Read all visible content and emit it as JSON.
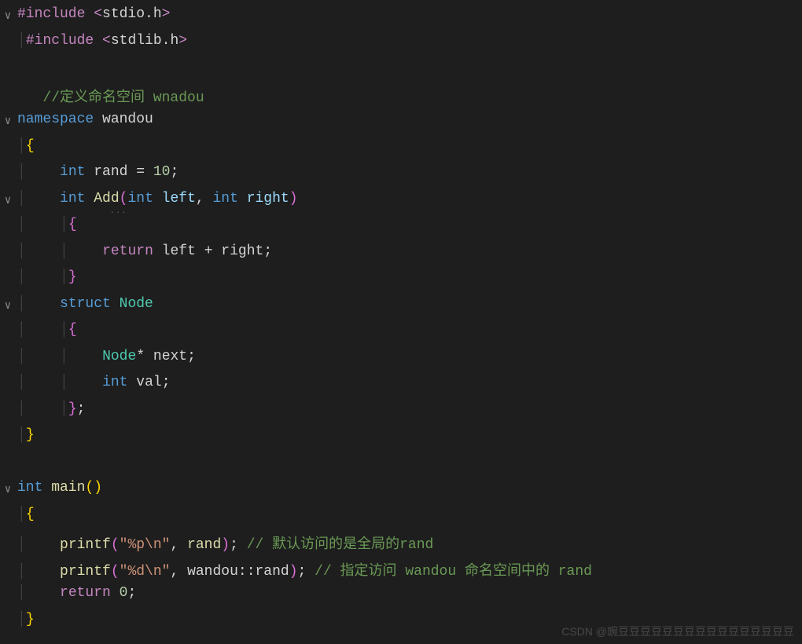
{
  "lines": {
    "l1_pre": "#include ",
    "l1_lt": "<",
    "l1_hdr": "stdio.h",
    "l1_gt": ">",
    "l2_pre": "#include ",
    "l2_lt": "<",
    "l2_hdr": "stdlib.h",
    "l2_gt": ">",
    "l4_comment": "//定义命名空间 wnadou",
    "l5_ns": "namespace",
    "l5_name": " wandou",
    "l6_brace": "{",
    "l7_int": "int",
    "l7_var": " rand ",
    "l7_eq": "= ",
    "l7_num": "10",
    "l7_semi": ";",
    "l8_int": "int",
    "l8_fn": " Add",
    "l8_lp": "(",
    "l8_int2": "int",
    "l8_p1": " left",
    "l8_comma": ", ",
    "l8_int3": "int",
    "l8_p2": " right",
    "l8_rp": ")",
    "l9_brace": "{",
    "l10_ret": "return",
    "l10_expr": " left ",
    "l10_plus": "+",
    "l10_expr2": " right",
    "l10_semi": ";",
    "l11_brace": "}",
    "l12_struct": "struct",
    "l12_name": " Node",
    "l13_brace": "{",
    "l14_type": "Node",
    "l14_star": "*",
    "l14_var": " next",
    "l14_semi": ";",
    "l15_int": "int",
    "l15_var": " val",
    "l15_semi": ";",
    "l16_brace": "}",
    "l16_semi": ";",
    "l17_brace": "}",
    "l19_int": "int",
    "l19_fn": " main",
    "l19_lp": "(",
    "l19_rp": ")",
    "l20_brace": "{",
    "l21_fn": "printf",
    "l21_lp": "(",
    "l21_str": "\"%p\\n\"",
    "l21_comma": ", ",
    "l21_arg": "rand",
    "l21_rp": ")",
    "l21_semi": "; ",
    "l21_comment": "// 默认访问的是全局的rand",
    "l22_fn": "printf",
    "l22_lp": "(",
    "l22_str": "\"%d\\n\"",
    "l22_comma": ", ",
    "l22_ns": "wandou",
    "l22_scope": "::",
    "l22_var": "rand",
    "l22_rp": ")",
    "l22_semi": "; ",
    "l22_comment": "// 指定访问 wandou 命名空间中的 rand",
    "l23_ret": "return",
    "l23_sp": " ",
    "l23_num": "0",
    "l23_semi": ";",
    "l24_brace": "}"
  },
  "fold_open": "∨",
  "guide": "│",
  "watermark": "CSDN @豌豆豆豆豆豆豆豆豆豆豆豆豆豆豆豆豆"
}
